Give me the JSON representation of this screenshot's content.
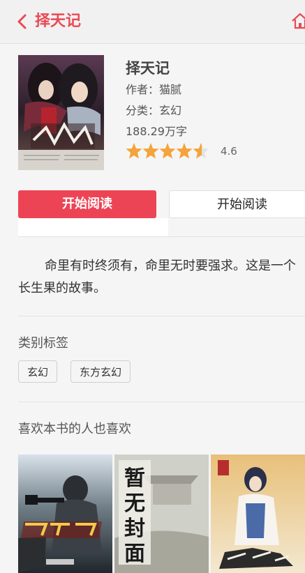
{
  "header": {
    "title": "择天记"
  },
  "book": {
    "title": "择天记",
    "author_line": "作者：猫腻",
    "category_line": "分类：玄幻",
    "word_count": "188.29万字",
    "rating": "4.6",
    "rating_value": 4.6,
    "rating_max": 5
  },
  "actions": {
    "start_reading_primary": "开始阅读",
    "start_reading_secondary": "开始阅读"
  },
  "intro": {
    "text": "命里有时终须有，命里无时要强求。这是一个长生果的故事。"
  },
  "tags": {
    "title": "类别标签",
    "items": [
      "玄幻",
      "东方玄幻"
    ]
  },
  "recommend": {
    "title": "喜欢本书的人也喜欢"
  },
  "colors": {
    "accent": "#ed4455",
    "star": "#f4a43a"
  }
}
